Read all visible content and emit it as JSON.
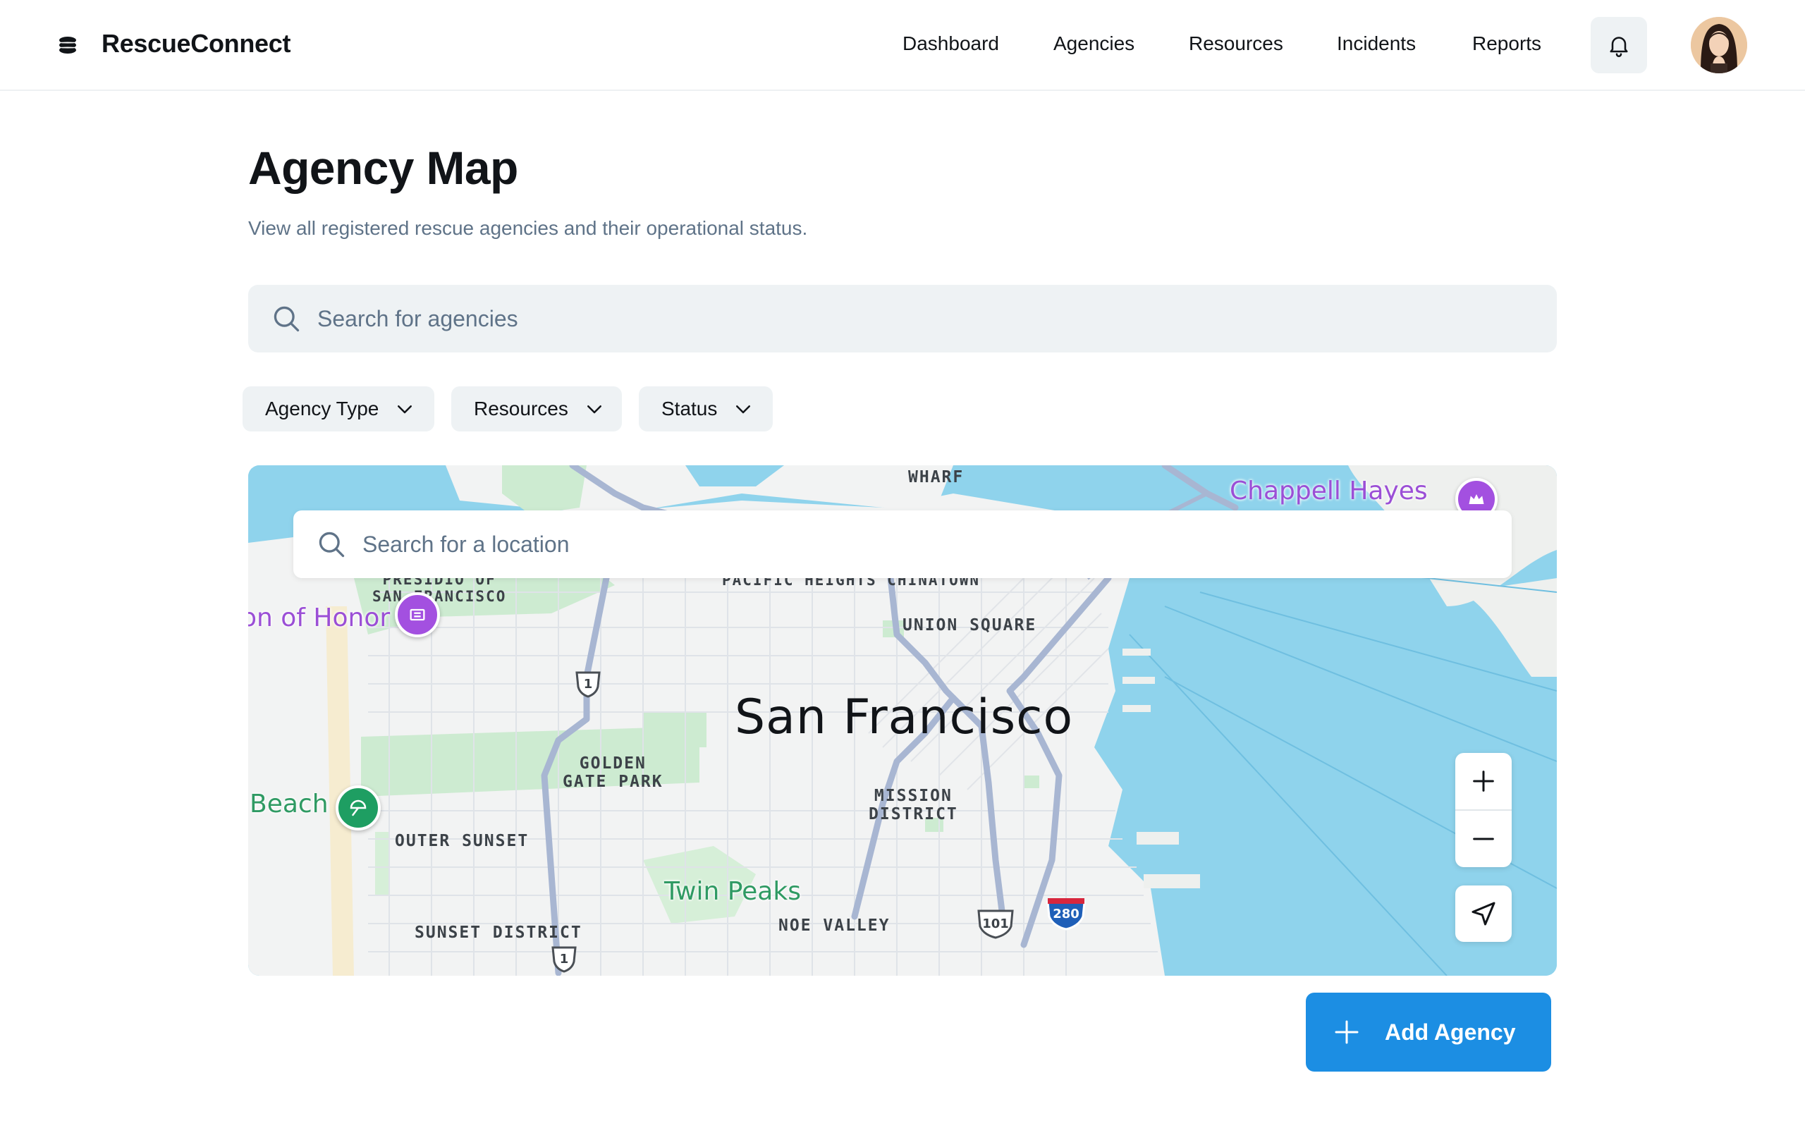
{
  "app": {
    "name": "RescueConnect"
  },
  "nav": {
    "items": [
      {
        "label": "Dashboard"
      },
      {
        "label": "Agencies"
      },
      {
        "label": "Resources"
      },
      {
        "label": "Incidents"
      },
      {
        "label": "Reports"
      }
    ],
    "notifications_icon": "bell-icon",
    "avatar": "user-avatar"
  },
  "page": {
    "title": "Agency Map",
    "subtitle": "View all registered rescue agencies and their operational status."
  },
  "agency_search": {
    "placeholder": "Search for agencies",
    "value": "",
    "icon": "search-icon"
  },
  "filters": [
    {
      "label": "Agency Type",
      "icon": "chevron-down-icon"
    },
    {
      "label": "Resources",
      "icon": "chevron-down-icon"
    },
    {
      "label": "Status",
      "icon": "chevron-down-icon"
    }
  ],
  "map": {
    "location_search": {
      "placeholder": "Search for a location",
      "value": ""
    },
    "city": "San Francisco",
    "districts": {
      "wharf": "WHARF",
      "presidio": "PRESIDIO OF\nSAN FRANCISCO",
      "pacific_heights": "PACIFIC HEIGHTS  CHINATOWN",
      "union_square": "UNION SQUARE",
      "golden_gate_park": "GOLDEN\nGATE PARK",
      "mission_district": "MISSION\nDISTRICT",
      "outer_sunset": "OUTER SUNSET",
      "sunset_district": "SUNSET DISTRICT",
      "noe_valley": "NOE VALLEY",
      "twin_peaks": "Twin Peaks"
    },
    "pois": {
      "chappell_hayes": "Chappell Hayes",
      "legion_of_honor": "on of Honor",
      "beach": "Beach"
    },
    "route_shields": {
      "r1": "1",
      "r1b": "1",
      "r101": "101",
      "r280": "280"
    },
    "controls": {
      "zoom_in_icon": "plus-icon",
      "zoom_out_icon": "minus-icon",
      "locate_icon": "navigation-arrow-icon"
    },
    "colors": {
      "water": "#8fd3ec",
      "land": "#f2f3f3",
      "park": "#cdebd1",
      "road": "#a8b6d2"
    }
  },
  "actions": {
    "add_agency": "Add Agency"
  },
  "colors": {
    "primary": "#1c8ee3",
    "muted_text": "#5f7388",
    "chip_bg": "#eef2f4"
  }
}
